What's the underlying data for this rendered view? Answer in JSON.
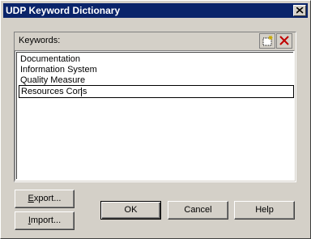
{
  "window": {
    "title": "UDP Keyword Dictionary"
  },
  "keywords": {
    "label": "Keywords:",
    "items": [
      "Documentation",
      "Information System",
      "Quality Measure"
    ],
    "editing_value": "Resources Cons"
  },
  "buttons": {
    "export_mnemonic": "E",
    "export_rest": "xport...",
    "import_mnemonic": "I",
    "import_rest": "mport...",
    "ok": "OK",
    "cancel": "Cancel",
    "help": "Help"
  },
  "icons": {
    "close": "close-icon",
    "new_item": "new-item-icon",
    "delete_item": "delete-icon"
  }
}
